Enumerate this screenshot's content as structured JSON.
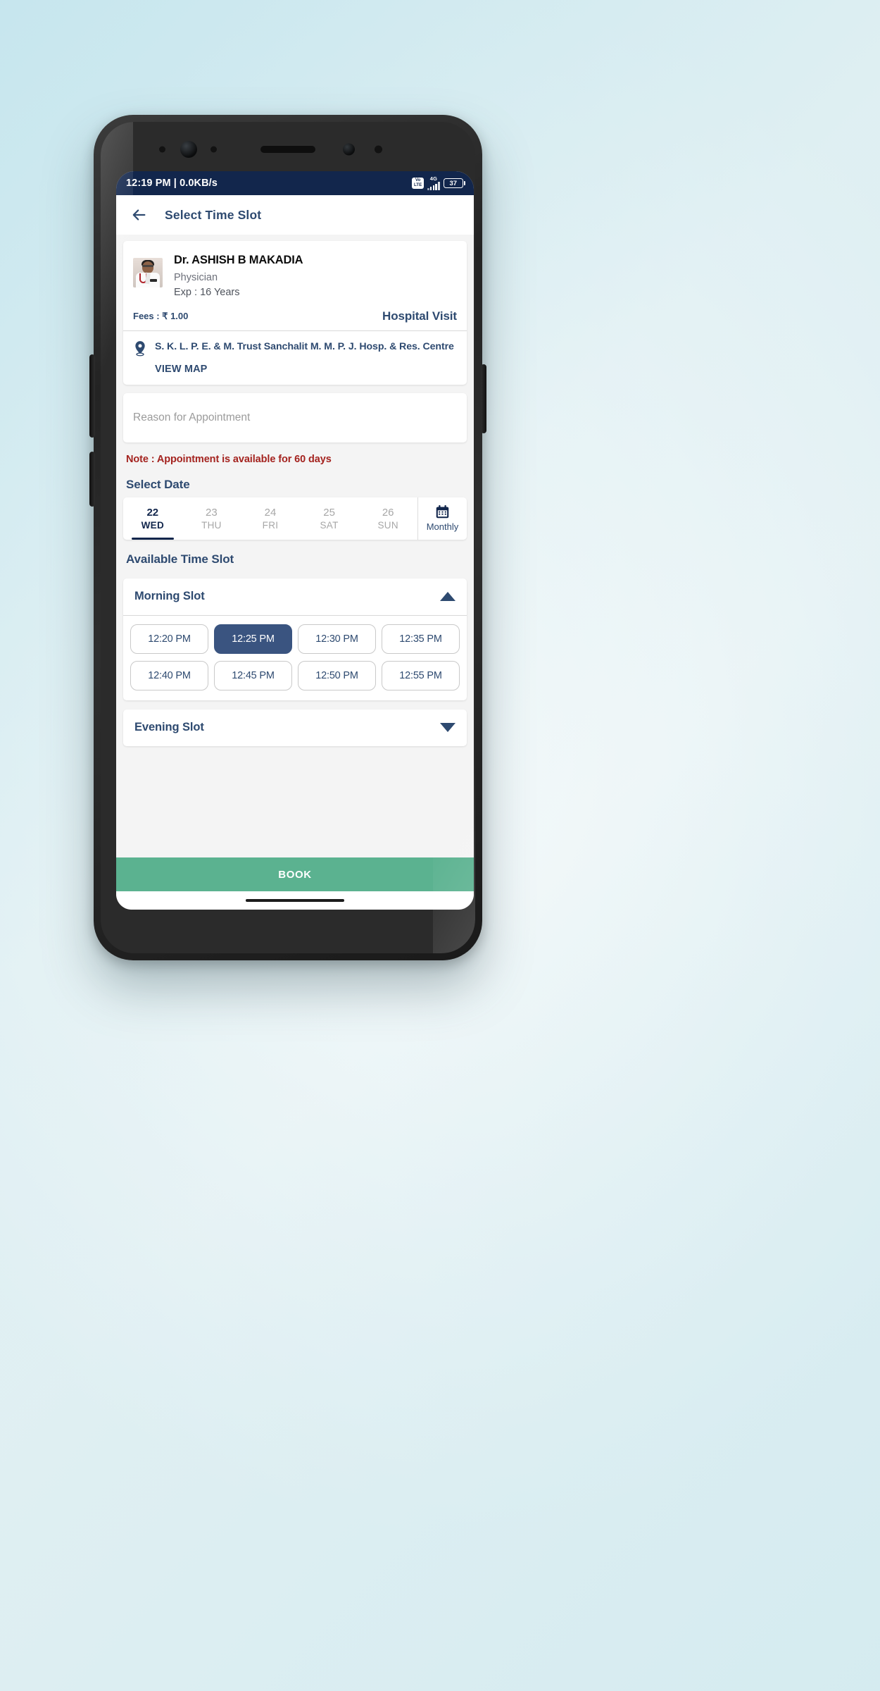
{
  "status_bar": {
    "time_and_speed": "12:19 PM | 0.0KB/s",
    "volte_line1": "Vo",
    "volte_line2": "LTE",
    "network_type": "4G",
    "battery_level": "37"
  },
  "appbar": {
    "back_icon": "arrow-left-icon",
    "title": "Select Time Slot"
  },
  "doctor": {
    "avatar_icon": "doctor-photo",
    "name": "Dr. ASHISH B MAKADIA",
    "specialty": "Physician",
    "experience": "Exp : 16 Years",
    "fees": "Fees : ₹ 1.00",
    "visit_type": "Hospital Visit"
  },
  "hospital": {
    "pin_icon": "location-pin-icon",
    "name": "S. K. L. P. E. & M. Trust Sanchalit M. M. P. J. Hosp. & Res. Centre",
    "view_map_label": "VIEW MAP"
  },
  "reason_field": {
    "placeholder": "Reason for Appointment",
    "value": ""
  },
  "note": "Note : Appointment is available for 60 days",
  "select_date": {
    "title": "Select Date",
    "days": [
      {
        "num": "22",
        "dow": "WED",
        "selected": true
      },
      {
        "num": "23",
        "dow": "THU",
        "selected": false
      },
      {
        "num": "24",
        "dow": "FRI",
        "selected": false
      },
      {
        "num": "25",
        "dow": "SAT",
        "selected": false
      },
      {
        "num": "26",
        "dow": "SUN",
        "selected": false
      }
    ],
    "monthly_label": "Monthly",
    "monthly_icon": "calendar-icon"
  },
  "time_slots": {
    "title": "Available Time Slot",
    "morning": {
      "label": "Morning Slot",
      "expanded": true,
      "chevron_icon": "caret-up-icon",
      "slots": [
        {
          "time": "12:20 PM",
          "selected": false
        },
        {
          "time": "12:25 PM",
          "selected": true
        },
        {
          "time": "12:30 PM",
          "selected": false
        },
        {
          "time": "12:35 PM",
          "selected": false
        },
        {
          "time": "12:40 PM",
          "selected": false
        },
        {
          "time": "12:45 PM",
          "selected": false
        },
        {
          "time": "12:50 PM",
          "selected": false
        },
        {
          "time": "12:55 PM",
          "selected": false
        }
      ]
    },
    "evening": {
      "label": "Evening Slot",
      "expanded": false,
      "chevron_icon": "caret-down-icon",
      "slots": []
    }
  },
  "book_button": {
    "label": "BOOK"
  },
  "colors": {
    "status_bar_bg": "#12264c",
    "primary": "#2e4a70",
    "selected_chip": "#3a5480",
    "note_red": "#a4231f",
    "book_green": "#5bb290",
    "page_bg": "#f4f4f4"
  }
}
